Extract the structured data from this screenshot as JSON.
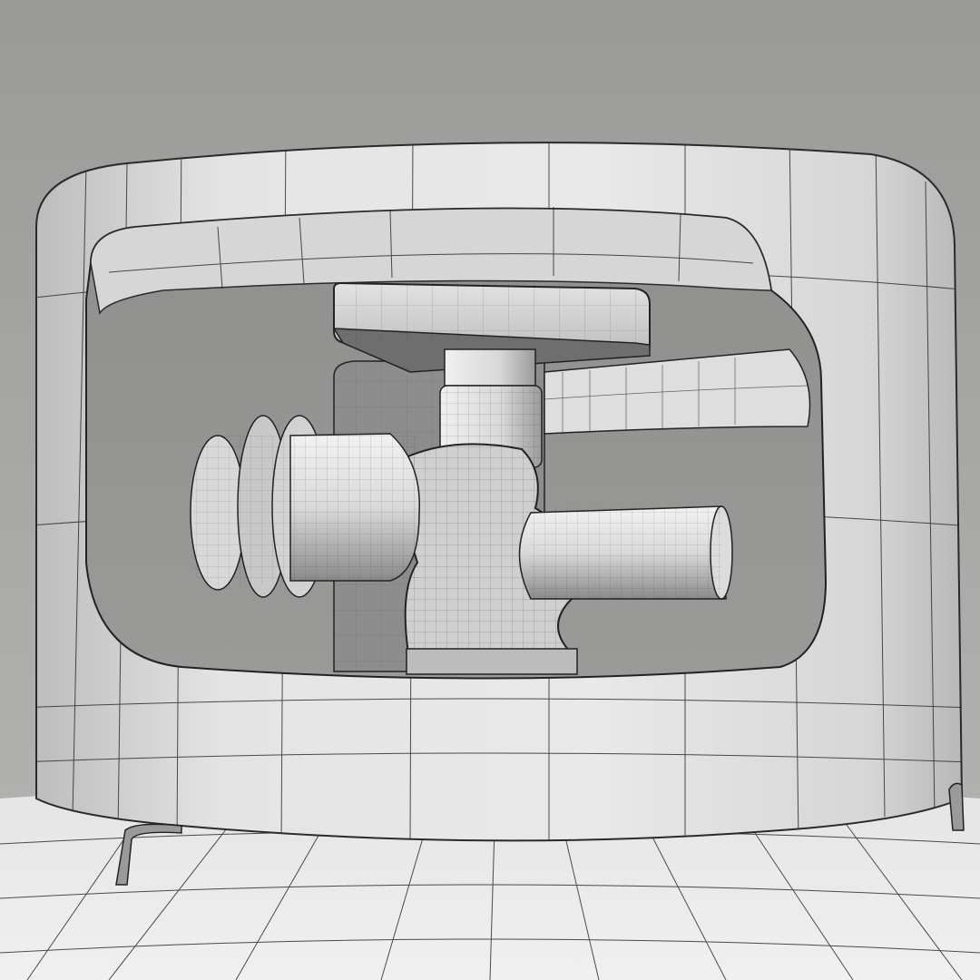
{
  "scene": {
    "subject": "propane-tank-valve-wireframe",
    "colors": {
      "background_top": "#9a9a98",
      "background_bottom": "#b6b6b4",
      "surface_light": "#e6e6e6",
      "surface_mid": "#cfcfcf",
      "surface_dark": "#8e8e8e",
      "wire": "#2e2e2e"
    }
  }
}
